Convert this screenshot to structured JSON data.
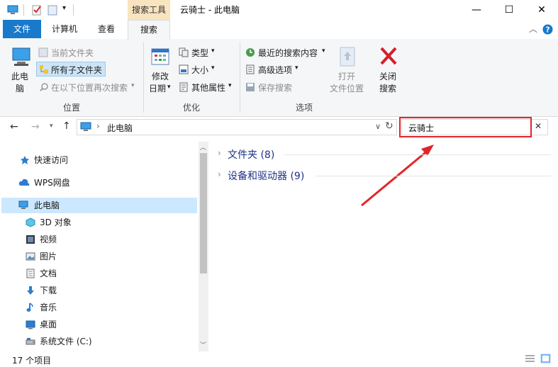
{
  "window": {
    "title": "云骑士 - 此电脑",
    "context_tab": "搜索工具"
  },
  "tabs": {
    "file": "文件",
    "computer": "计算机",
    "view": "查看",
    "search": "搜索"
  },
  "ribbon": {
    "location": {
      "this_pc": [
        "此电",
        "脑"
      ],
      "current_folder": "当前文件夹",
      "all_subfolders": "所有子文件夹",
      "search_again": "在以下位置再次搜索",
      "label": "位置"
    },
    "refine": {
      "date_modified": [
        "修改",
        "日期"
      ],
      "type": "类型",
      "size": "大小",
      "other_props": "其他属性",
      "label": "优化"
    },
    "options": {
      "recent_searches": "最近的搜索内容",
      "advanced": "高级选项",
      "save_search": "保存搜索",
      "open_location": [
        "打开",
        "文件位置"
      ],
      "close_search": [
        "关闭",
        "搜索"
      ],
      "label": "选项"
    }
  },
  "address": {
    "path": "此电脑",
    "search_value": "云骑士"
  },
  "nav": {
    "quick_access": "快速访问",
    "wps": "WPS网盘",
    "this_pc": "此电脑",
    "items": [
      "3D 对象",
      "视频",
      "图片",
      "文档",
      "下载",
      "音乐",
      "桌面",
      "系统文件 (C:)"
    ]
  },
  "content": {
    "folders": "文件夹 (8)",
    "devices": "设备和驱动器 (9)"
  },
  "status": {
    "count": "17 个项目"
  },
  "colors": {
    "accent": "#1979ca",
    "highlight_red": "#e0252b",
    "context_tab": "#f9e4c0",
    "section_text": "#1e3287"
  }
}
